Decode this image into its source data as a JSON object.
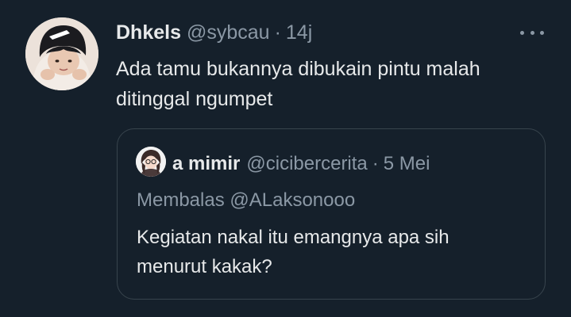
{
  "tweet": {
    "author_name": "Dhkels",
    "author_handle": "@sybcau",
    "separator": "·",
    "time": "14j",
    "text_line1": "Ada tamu bukannya dibukain pintu malah",
    "text_line2": "ditinggal ngumpet",
    "more_icon": "more-horizontal-icon"
  },
  "quote": {
    "author_name": "a mimir",
    "author_handle": "@cicibercerita",
    "separator": "·",
    "time": "5 Mei",
    "reply_to": "Membalas @ALaksonooo",
    "text_line1": "Kegiatan nakal itu emangnya apa sih",
    "text_line2": "menurut kakak?"
  },
  "colors": {
    "background": "#15202b",
    "primary_text": "#e7e9ea",
    "secondary_text": "#8b98a5",
    "border": "#38444d"
  }
}
